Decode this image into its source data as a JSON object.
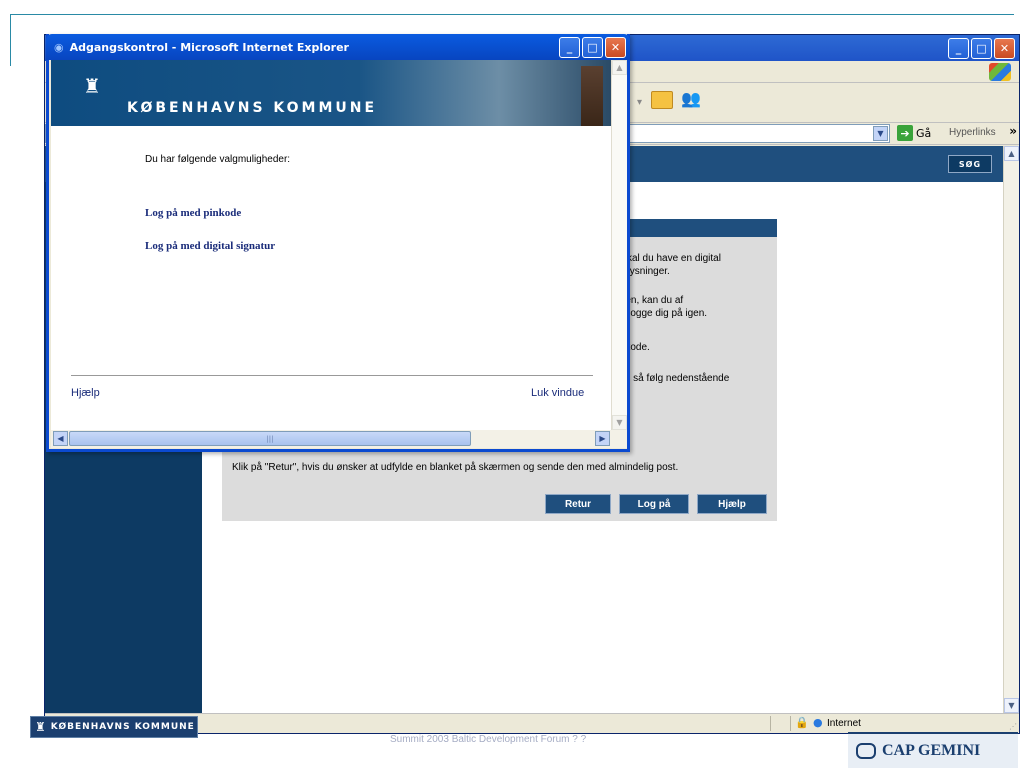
{
  "bg_window": {
    "address_go_label": "Gå",
    "hyperlinks_label": "Hyperlinks",
    "search_button": "SØG",
    "panel": {
      "line1": "skal du have en digital",
      "line2": "plysninger.",
      "line3": "ren, kan du af",
      "line4": "r logge dig på igen.",
      "line5": "-kode.",
      "line6": "e, så følg nedenstående",
      "retur_note": "Klik på \"Retur\", hvis du ønsker at udfylde en blanket på skærmen og sende den med almindelig post.",
      "buttons": {
        "retur": "Retur",
        "login": "Log på",
        "help": "Hjælp"
      }
    },
    "status": {
      "zone": "Internet"
    }
  },
  "popup": {
    "title": "Adgangskontrol - Microsoft Internet Explorer",
    "banner_title": "KØBENHAVNS KOMMUNE",
    "intro": "Du har følgende valgmuligheder:",
    "links": [
      "Log på med pinkode",
      "Log på med digital signatur"
    ],
    "help": "Hjælp",
    "close": "Luk vindue"
  },
  "slide_footer": {
    "logo_text": "KØBENHAVNS KOMMUNE",
    "center_text": "Summit 2003 Baltic Development Forum ? ?",
    "right_text": "CAP GEMINI"
  },
  "icons": {
    "window_buttons": [
      "minimize-icon",
      "maximize-icon",
      "close-icon"
    ],
    "status": [
      "ie-page-icon",
      "lock-icon",
      "globe-icon"
    ]
  },
  "colors": {
    "xp_title_blue": "#0a5be0",
    "kk_dark_blue": "#0d3a63",
    "kk_header_blue": "#1f4f7e",
    "link_navy": "#1a2c7a"
  }
}
